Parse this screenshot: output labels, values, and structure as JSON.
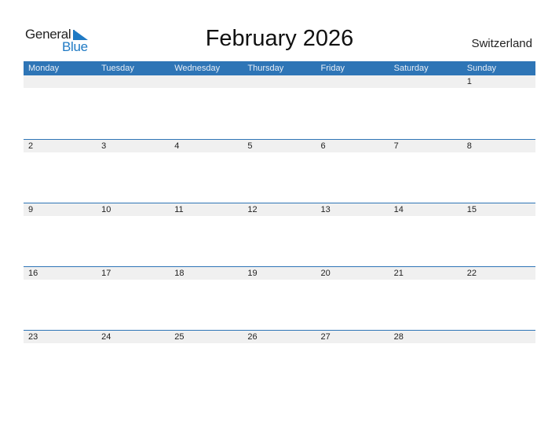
{
  "logo": {
    "word1": "General",
    "word2": "Blue"
  },
  "title": "February 2026",
  "country": "Switzerland",
  "colors": {
    "accent": "#2e75b6",
    "strip": "#f0f0f0",
    "logo_blue": "#1f7ac4"
  },
  "weekdays": [
    "Monday",
    "Tuesday",
    "Wednesday",
    "Thursday",
    "Friday",
    "Saturday",
    "Sunday"
  ],
  "weeks": [
    [
      "",
      "",
      "",
      "",
      "",
      "",
      "1"
    ],
    [
      "2",
      "3",
      "4",
      "5",
      "6",
      "7",
      "8"
    ],
    [
      "9",
      "10",
      "11",
      "12",
      "13",
      "14",
      "15"
    ],
    [
      "16",
      "17",
      "18",
      "19",
      "20",
      "21",
      "22"
    ],
    [
      "23",
      "24",
      "25",
      "26",
      "27",
      "28",
      ""
    ]
  ]
}
